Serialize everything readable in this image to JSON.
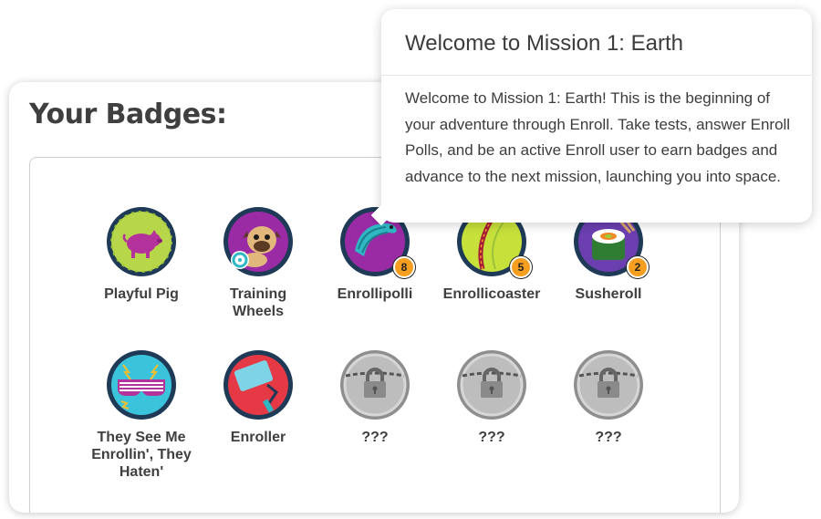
{
  "card": {
    "title": "Your Badges:"
  },
  "badges": [
    {
      "name": "Playful Pig",
      "icon": "pig-icon"
    },
    {
      "name": "Training Wheels",
      "icon": "pug-icon"
    },
    {
      "name": "Enrollipolli",
      "icon": "pillbug-icon",
      "count": "8"
    },
    {
      "name": "Enrollicoaster",
      "icon": "rollercoaster-icon",
      "count": "5"
    },
    {
      "name": "Susheroll",
      "icon": "sushi-icon",
      "count": "2"
    },
    {
      "name": "They See Me Enrollin', They Haten'",
      "icon": "shutter-shades-icon"
    },
    {
      "name": "Enroller",
      "icon": "paint-roller-icon"
    },
    {
      "name": "???",
      "icon": "locked-badge-icon"
    },
    {
      "name": "???",
      "icon": "locked-badge-icon"
    },
    {
      "name": "???",
      "icon": "locked-badge-icon"
    }
  ],
  "tooltip": {
    "title": "Welcome to Mission 1: Earth",
    "body": "Welcome to Mission 1: Earth! This is the beginning of your adventure through Enroll. Take tests, answer Enroll Polls, and be an active Enroll user to earn badges and advance to the next mission, launching you into space."
  },
  "colors": {
    "count_badge": "#f59e1f",
    "locked_gray": "#a9a9a9",
    "badge_ring": "#1e3a57"
  }
}
